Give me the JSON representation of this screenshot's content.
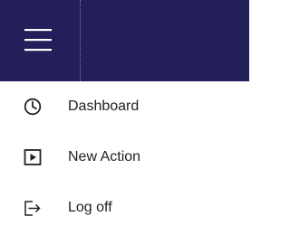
{
  "header": {
    "menu_icon": "hamburger-menu-icon",
    "background_color": "#221f5b"
  },
  "menu": {
    "items": [
      {
        "label": "Dashboard",
        "icon": "clock-icon"
      },
      {
        "label": "New Action",
        "icon": "play-box-icon"
      },
      {
        "label": "Log off",
        "icon": "logout-icon"
      }
    ]
  }
}
